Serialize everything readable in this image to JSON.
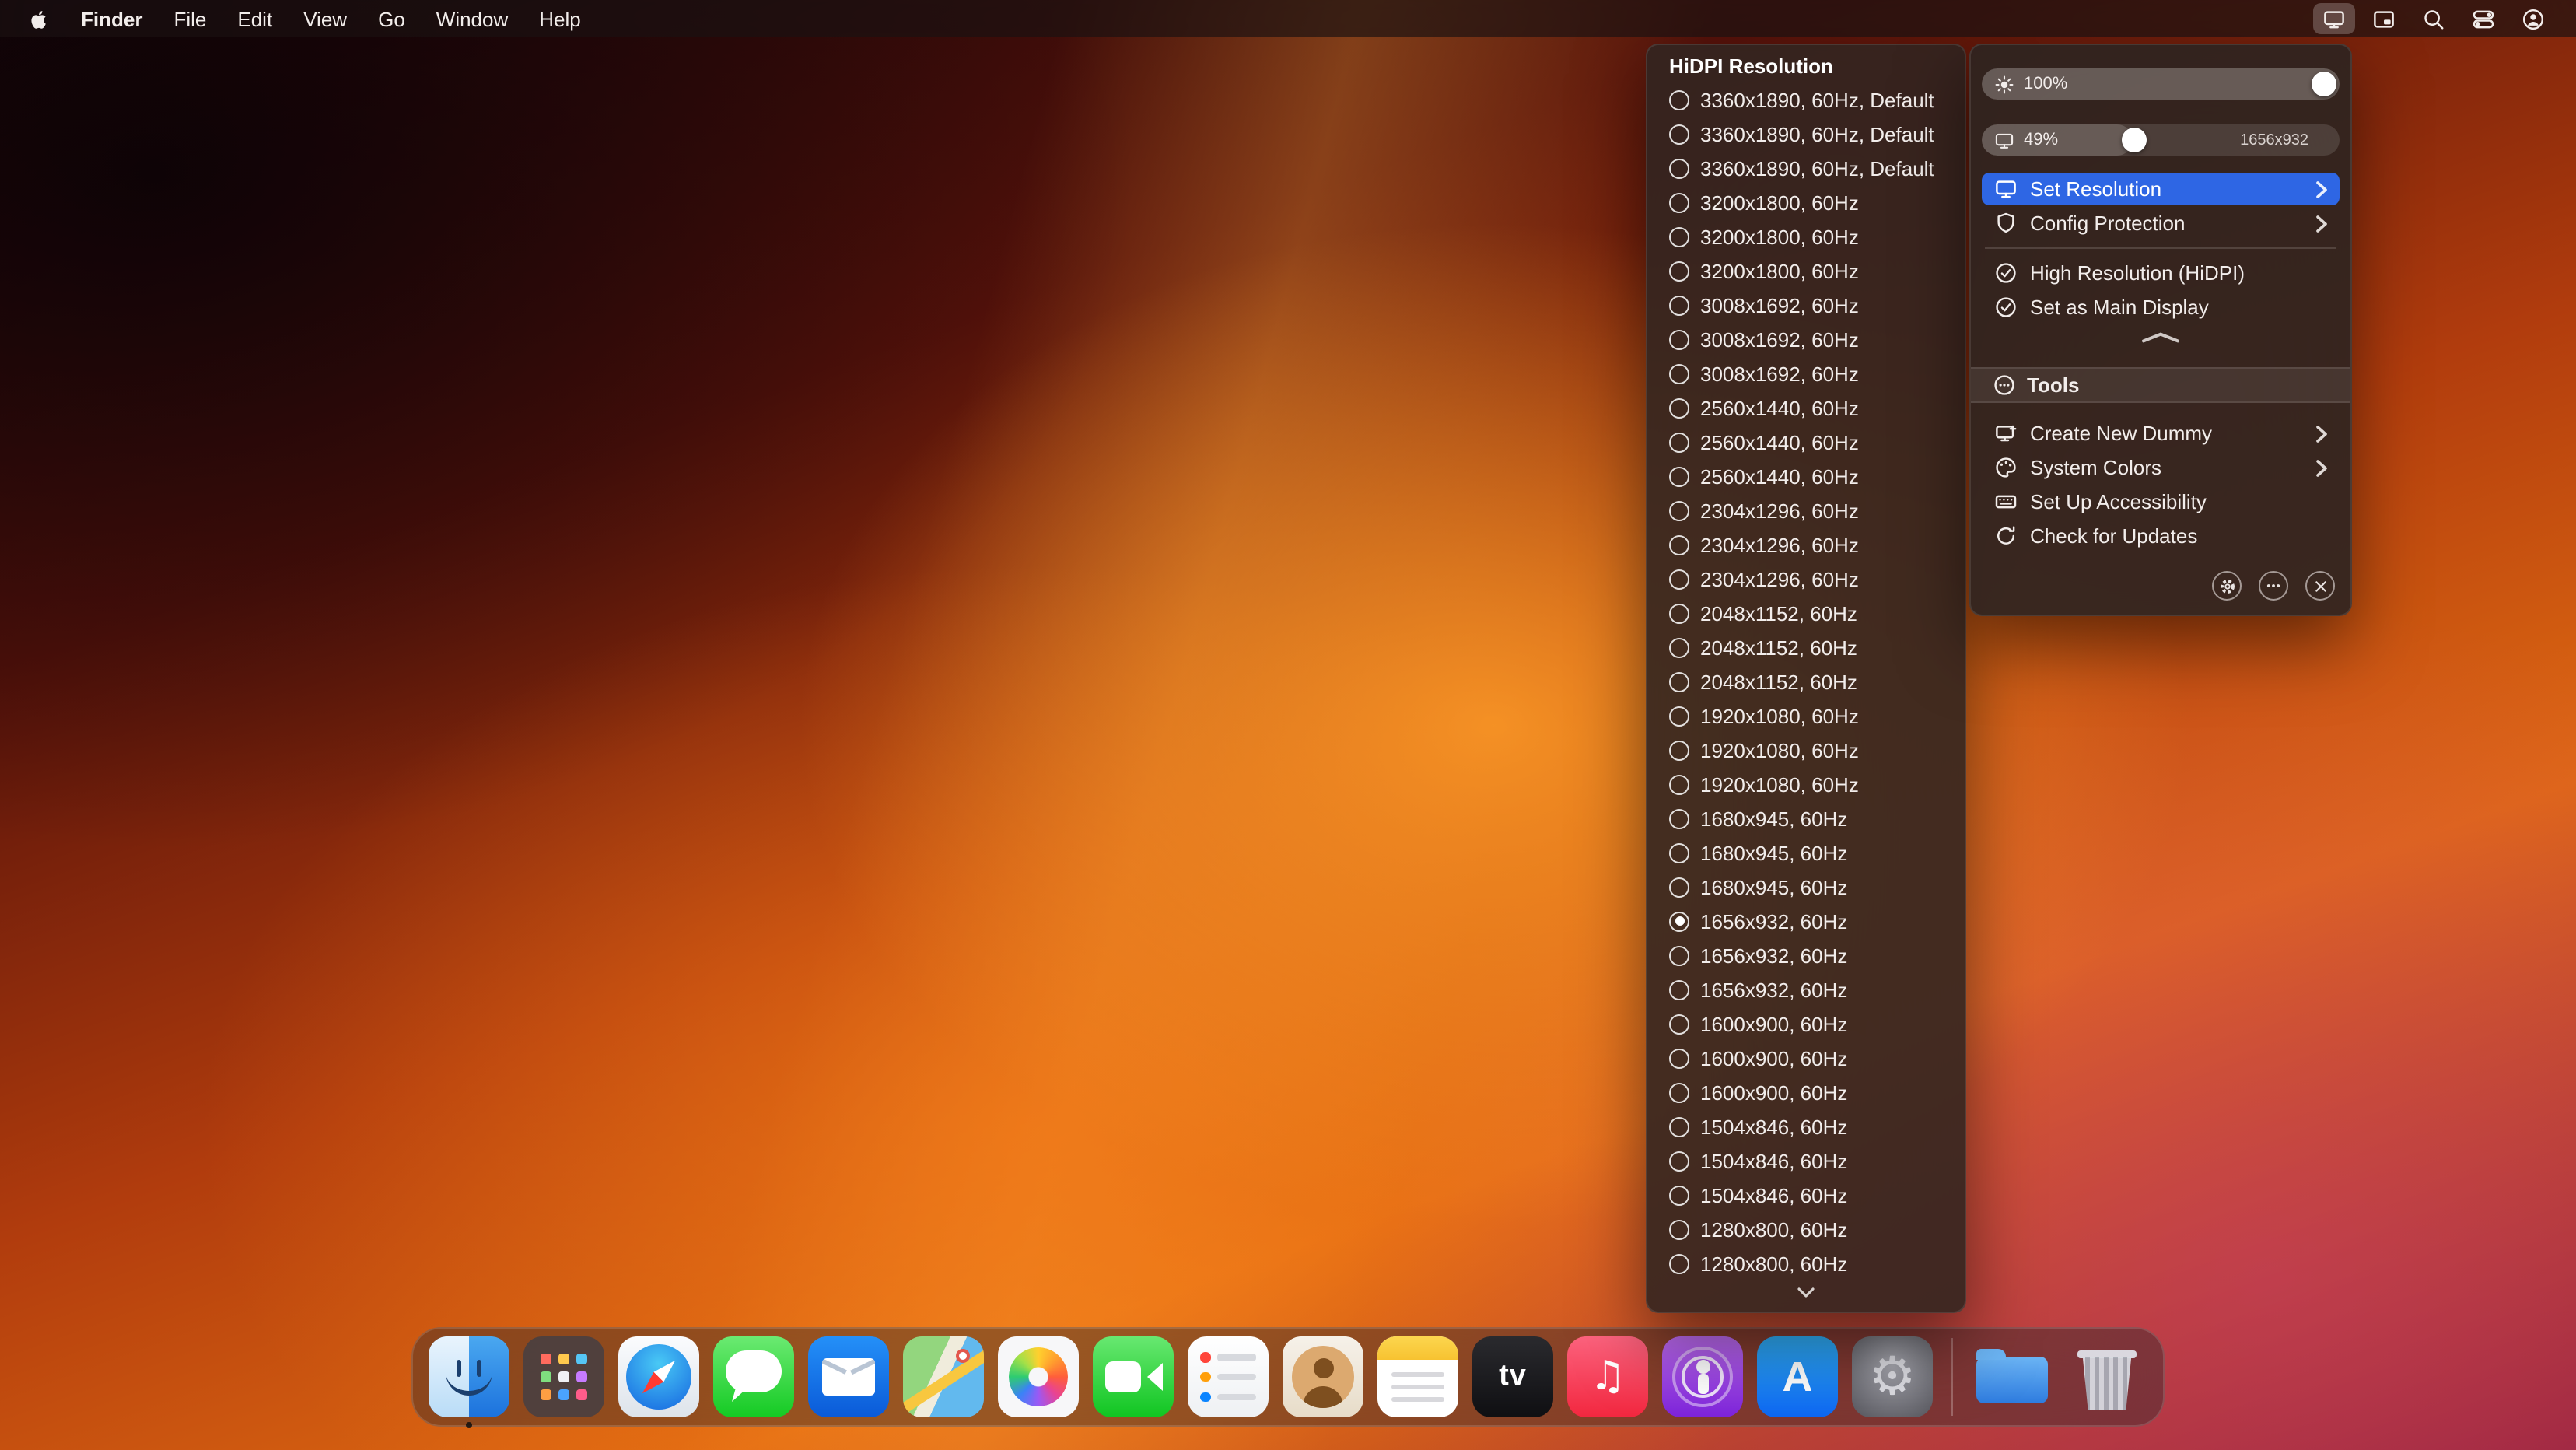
{
  "menu_bar": {
    "app_name": "Finder",
    "menus": [
      "File",
      "Edit",
      "View",
      "Go",
      "Window",
      "Help"
    ],
    "status_icons": [
      {
        "id": "display",
        "active": true
      },
      {
        "id": "window",
        "active": false
      },
      {
        "id": "search",
        "active": false
      },
      {
        "id": "control-center",
        "active": false
      },
      {
        "id": "user",
        "active": false
      }
    ]
  },
  "resolution_menu": {
    "header": "HiDPI Resolution",
    "items": [
      {
        "label": "3360x1890, 60Hz, Default",
        "selected": false
      },
      {
        "label": "3360x1890, 60Hz, Default",
        "selected": false
      },
      {
        "label": "3360x1890, 60Hz, Default",
        "selected": false
      },
      {
        "label": "3200x1800, 60Hz",
        "selected": false
      },
      {
        "label": "3200x1800, 60Hz",
        "selected": false
      },
      {
        "label": "3200x1800, 60Hz",
        "selected": false
      },
      {
        "label": "3008x1692, 60Hz",
        "selected": false
      },
      {
        "label": "3008x1692, 60Hz",
        "selected": false
      },
      {
        "label": "3008x1692, 60Hz",
        "selected": false
      },
      {
        "label": "2560x1440, 60Hz",
        "selected": false
      },
      {
        "label": "2560x1440, 60Hz",
        "selected": false
      },
      {
        "label": "2560x1440, 60Hz",
        "selected": false
      },
      {
        "label": "2304x1296, 60Hz",
        "selected": false
      },
      {
        "label": "2304x1296, 60Hz",
        "selected": false
      },
      {
        "label": "2304x1296, 60Hz",
        "selected": false
      },
      {
        "label": "2048x1152, 60Hz",
        "selected": false
      },
      {
        "label": "2048x1152, 60Hz",
        "selected": false
      },
      {
        "label": "2048x1152, 60Hz",
        "selected": false
      },
      {
        "label": "1920x1080, 60Hz",
        "selected": false
      },
      {
        "label": "1920x1080, 60Hz",
        "selected": false
      },
      {
        "label": "1920x1080, 60Hz",
        "selected": false
      },
      {
        "label": "1680x945, 60Hz",
        "selected": false
      },
      {
        "label": "1680x945, 60Hz",
        "selected": false
      },
      {
        "label": "1680x945, 60Hz",
        "selected": false
      },
      {
        "label": "1656x932, 60Hz",
        "selected": true
      },
      {
        "label": "1656x932, 60Hz",
        "selected": false
      },
      {
        "label": "1656x932, 60Hz",
        "selected": false
      },
      {
        "label": "1600x900, 60Hz",
        "selected": false
      },
      {
        "label": "1600x900, 60Hz",
        "selected": false
      },
      {
        "label": "1600x900, 60Hz",
        "selected": false
      },
      {
        "label": "1504x846, 60Hz",
        "selected": false
      },
      {
        "label": "1504x846, 60Hz",
        "selected": false
      },
      {
        "label": "1504x846, 60Hz",
        "selected": false
      },
      {
        "label": "1280x800, 60Hz",
        "selected": false
      },
      {
        "label": "1280x800, 60Hz",
        "selected": false
      }
    ]
  },
  "display_panel": {
    "sliders": [
      {
        "id": "brightness",
        "icon": "sun",
        "value": "100%",
        "percent": 100,
        "right_label": ""
      },
      {
        "id": "resolution-scale",
        "icon": "display",
        "value": "49%",
        "percent": 42,
        "right_label": "1656x932"
      }
    ],
    "primary_items": [
      {
        "label": "Set Resolution",
        "icon": "display",
        "submenu": true,
        "highlighted": true
      },
      {
        "label": "Config Protection",
        "icon": "shield",
        "submenu": true,
        "highlighted": false
      }
    ],
    "checked_items": [
      {
        "label": "High Resolution (HiDPI)",
        "icon": "check-circle",
        "submenu": false,
        "highlighted": false
      },
      {
        "label": "Set as Main Display",
        "icon": "check-circle",
        "submenu": false,
        "highlighted": false
      }
    ],
    "tools": {
      "label": "Tools",
      "icon": "more-circle",
      "items": [
        {
          "label": "Create New Dummy",
          "icon": "display-plus",
          "submenu": true,
          "highlighted": false
        },
        {
          "label": "System Colors",
          "icon": "palette",
          "submenu": true,
          "highlighted": false
        },
        {
          "label": "Set Up Accessibility",
          "icon": "keyboard",
          "submenu": false,
          "highlighted": false
        },
        {
          "label": "Check for Updates",
          "icon": "refresh",
          "submenu": false,
          "highlighted": false
        }
      ]
    },
    "footer_buttons": [
      {
        "id": "settings",
        "icon": "gear"
      },
      {
        "id": "more",
        "icon": "ellipsis"
      },
      {
        "id": "close",
        "icon": "close"
      }
    ]
  },
  "dock": {
    "apps": [
      {
        "id": "finder",
        "label": "Finder",
        "running": true
      },
      {
        "id": "launchpad",
        "label": "Launchpad",
        "running": false
      },
      {
        "id": "safari",
        "label": "Safari",
        "running": false
      },
      {
        "id": "messages",
        "label": "Messages",
        "running": false
      },
      {
        "id": "mail",
        "label": "Mail",
        "running": false
      },
      {
        "id": "maps",
        "label": "Maps",
        "running": false
      },
      {
        "id": "photos",
        "label": "Photos",
        "running": false
      },
      {
        "id": "facetime",
        "label": "FaceTime",
        "running": false
      },
      {
        "id": "reminders",
        "label": "Reminders",
        "running": false
      },
      {
        "id": "contacts",
        "label": "Contacts",
        "running": false
      },
      {
        "id": "notes",
        "label": "Notes",
        "running": false
      },
      {
        "id": "tv",
        "label": "TV",
        "running": false
      },
      {
        "id": "music",
        "label": "Music",
        "running": false
      },
      {
        "id": "podcasts",
        "label": "Podcasts",
        "running": false
      },
      {
        "id": "appstore",
        "label": "App Store",
        "running": false
      },
      {
        "id": "settings",
        "label": "System Settings",
        "running": false
      },
      {
        "id": "downloads",
        "label": "Downloads",
        "running": false
      },
      {
        "id": "trash",
        "label": "Trash",
        "running": false
      }
    ]
  },
  "colors": {
    "accent_blue": "#2e66e4",
    "panel_bg": "#2e2421",
    "menu_text": "#f2edeb"
  }
}
